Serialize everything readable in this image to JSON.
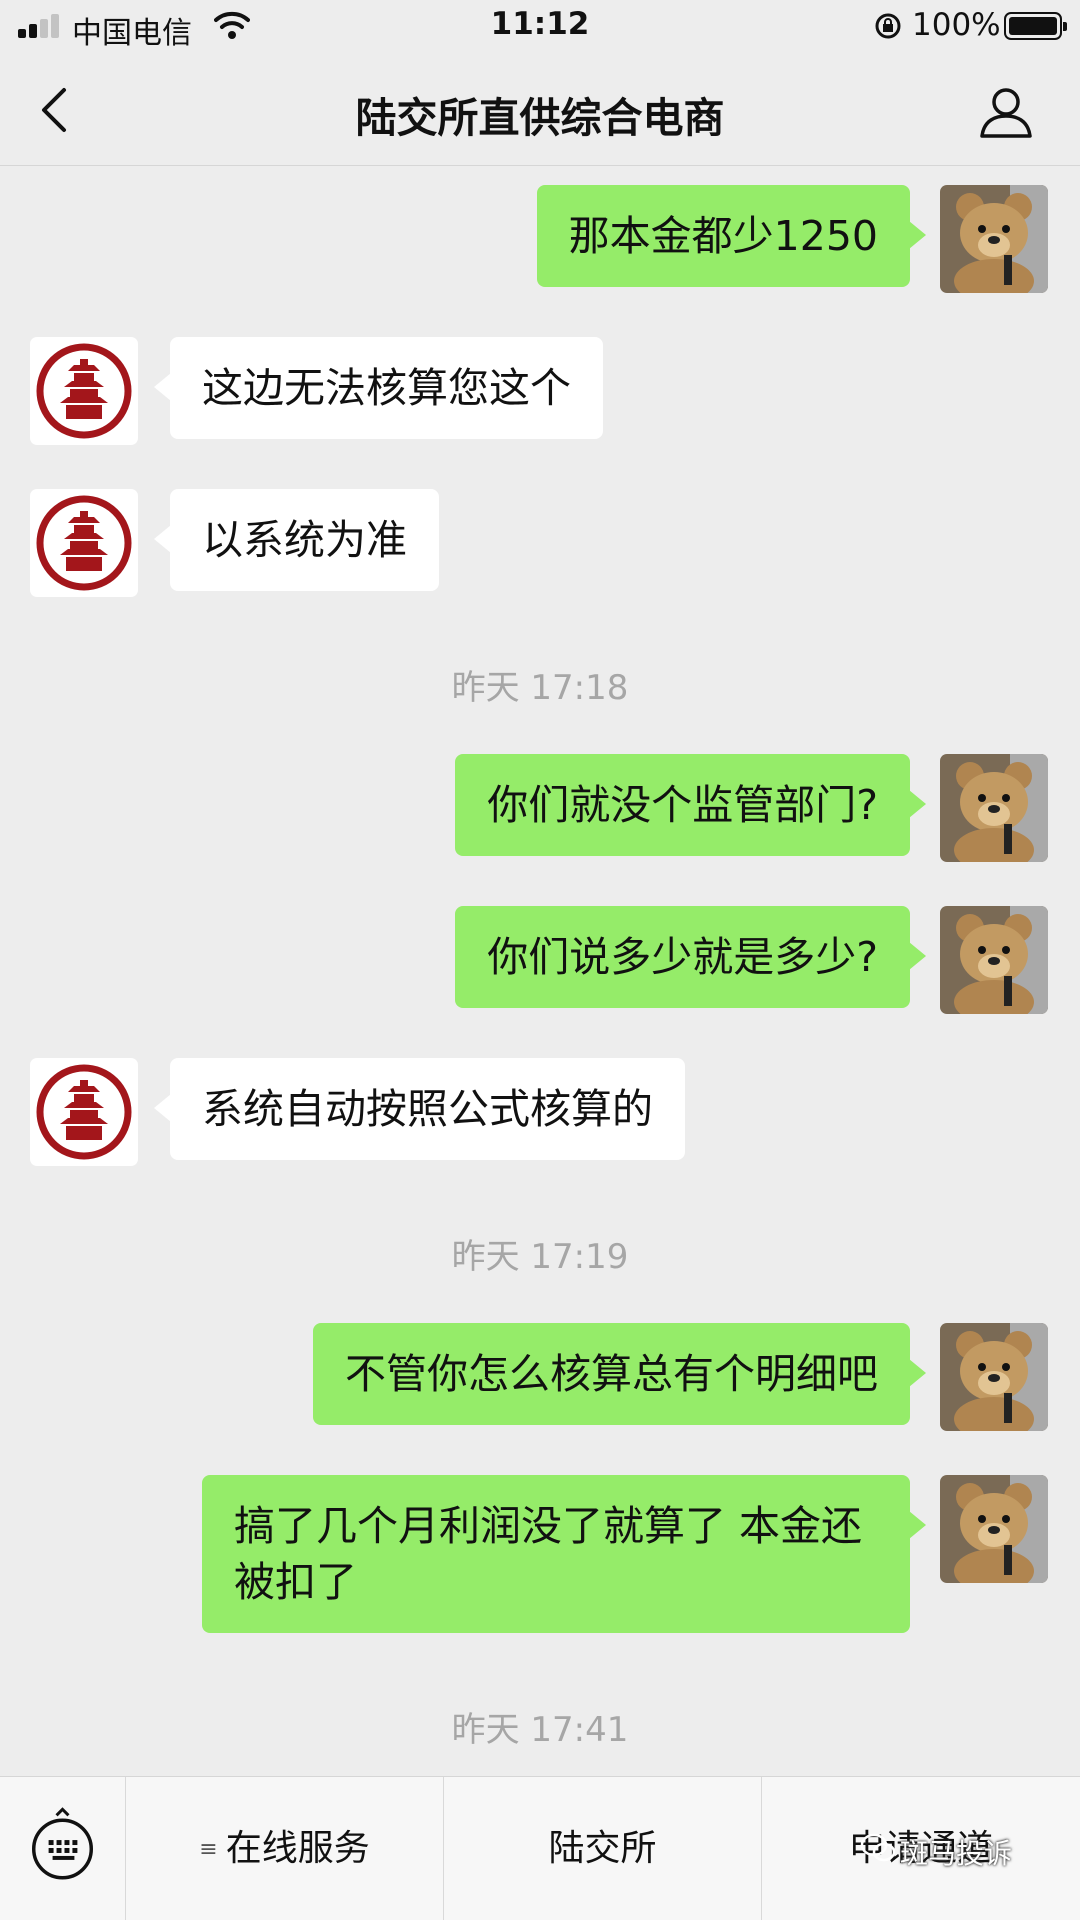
{
  "status_bar": {
    "carrier": "中国电信",
    "time": "11:12",
    "battery": "100%"
  },
  "nav": {
    "title": "陆交所直供综合电商",
    "back_icon": "chevron-left-icon",
    "profile_icon": "person-icon"
  },
  "messages": [
    {
      "side": "out",
      "text": "那本金都少1250"
    },
    {
      "side": "in",
      "text": "这边无法核算您这个"
    },
    {
      "side": "in",
      "text": "以系统为准"
    },
    {
      "side": "time",
      "text": "昨天 17:18"
    },
    {
      "side": "out",
      "text": "你们就没个监管部门?"
    },
    {
      "side": "out",
      "text": "你们说多少就是多少?"
    },
    {
      "side": "in",
      "text": "系统自动按照公式核算的"
    },
    {
      "side": "time",
      "text": "昨天 17:19"
    },
    {
      "side": "out",
      "text": "不管你怎么核算总有个明细吧"
    },
    {
      "side": "out",
      "text": "搞了几个月利润没了就算了 本金还被扣了"
    },
    {
      "side": "time",
      "text": "昨天 17:41"
    }
  ],
  "bottom_menu": {
    "items": [
      {
        "label": "在线服务"
      },
      {
        "label": "陆交所"
      },
      {
        "label": "申请通道"
      }
    ]
  },
  "watermark": "斑马投诉",
  "colors": {
    "outgoing_bubble": "#95ec69",
    "incoming_bubble": "#ffffff",
    "background": "#ededed",
    "logo_red": "#a3161b"
  }
}
